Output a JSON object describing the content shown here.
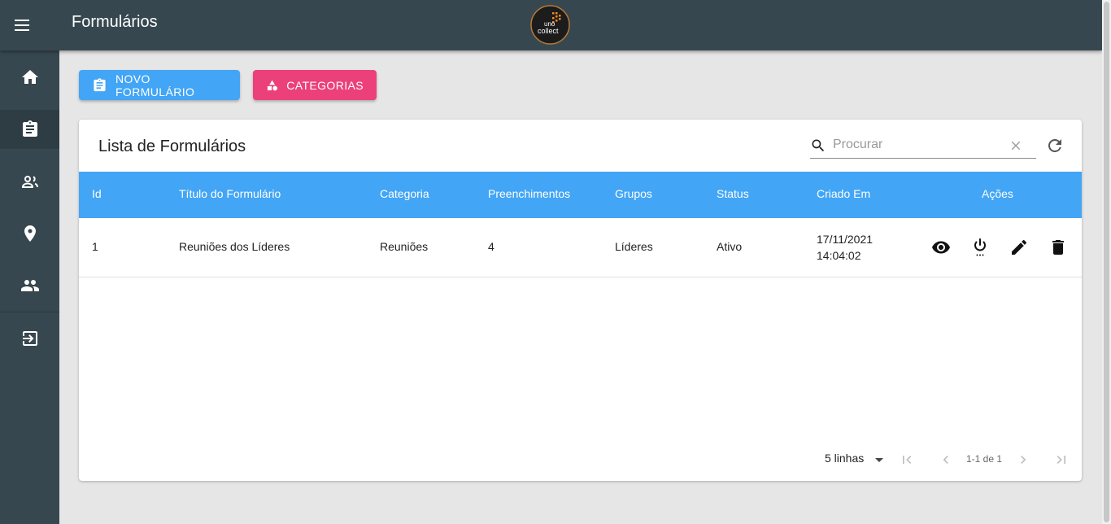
{
  "app": {
    "title": "Formulários",
    "logo_line1": "uno",
    "logo_line2": "collect"
  },
  "sidebar": {
    "items": [
      {
        "name": "home-icon",
        "active": false
      },
      {
        "name": "clipboard-icon",
        "active": true
      },
      {
        "name": "users-icon",
        "active": false
      },
      {
        "name": "location-pin-icon",
        "active": false
      },
      {
        "name": "group-icon",
        "active": false
      },
      {
        "name": "logout-icon",
        "active": false
      }
    ]
  },
  "buttons": {
    "new_form": "NOVO FORMULÁRIO",
    "categories": "CATEGORIAS"
  },
  "card": {
    "title": "Lista de Formulários",
    "search_placeholder": "Procurar"
  },
  "table": {
    "headers": [
      "Id",
      "Título do Formulário",
      "Categoria",
      "Preenchimentos",
      "Grupos",
      "Status",
      "Criado Em",
      "Ações"
    ],
    "rows": [
      {
        "id": "1",
        "title": "Reuniões dos Líderes",
        "category": "Reuniões",
        "fills": "4",
        "groups": "Líderes",
        "status": "Ativo",
        "created_date": "17/11/2021",
        "created_time": "14:04:02",
        "actions": [
          "view-icon",
          "power-icon",
          "edit-icon",
          "delete-icon"
        ]
      }
    ]
  },
  "pagination": {
    "rows_per_page": "5 linhas",
    "info": "1-1 de 1"
  },
  "colors": {
    "appbar": "#37474f",
    "table_header": "#42a5f5",
    "primary_button": "#42a5f5",
    "secondary_button": "#ec407a",
    "background": "#e6e6e6"
  }
}
